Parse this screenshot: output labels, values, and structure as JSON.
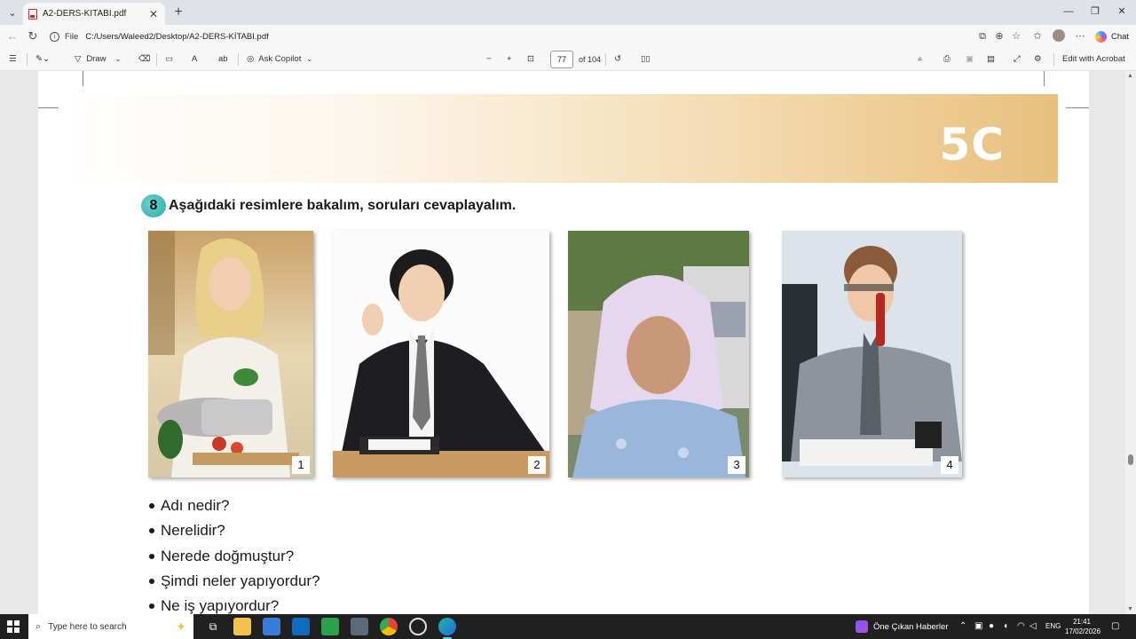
{
  "browser": {
    "tab_title": "A2-DERS-KİTABI.pdf",
    "url_scheme": "File",
    "url": "C:/Users/Waleed2/Desktop/A2-DERS-KİTABI.pdf",
    "chat_label": "Chat"
  },
  "pdf_toolbar": {
    "draw_label": "Draw",
    "ask_copilot_label": "Ask Copilot",
    "current_page": "77",
    "page_total": "of 104",
    "edit_label": "Edit with Acrobat"
  },
  "document": {
    "unit_label": "5C",
    "exercise_number": "8",
    "exercise_title": "Aşağıdaki resimlere bakalım, soruları cevaplayalım.",
    "photos": [
      {
        "number": "1",
        "icon": "woman-cooking-photo"
      },
      {
        "number": "2",
        "icon": "young-businessman-photo"
      },
      {
        "number": "3",
        "icon": "elderly-woman-headscarf-photo"
      },
      {
        "number": "4",
        "icon": "man-on-phone-photo"
      }
    ],
    "questions": [
      "Adı nedir?",
      "Nerelidir?",
      "Nerede doğmuştur?",
      "Şimdi neler yapıyordur?",
      "Ne iş yapıyordur?"
    ]
  },
  "taskbar": {
    "search_placeholder": "Type here to search",
    "news_label": "Öne Çıkan Haberler",
    "language": "ENG",
    "time": "21:41",
    "date": "17/02/2026"
  },
  "colors": {
    "banner_gold": "#e8c07e",
    "exercise_badge": "#2fa9a6",
    "taskbar_bg": "#202020"
  }
}
